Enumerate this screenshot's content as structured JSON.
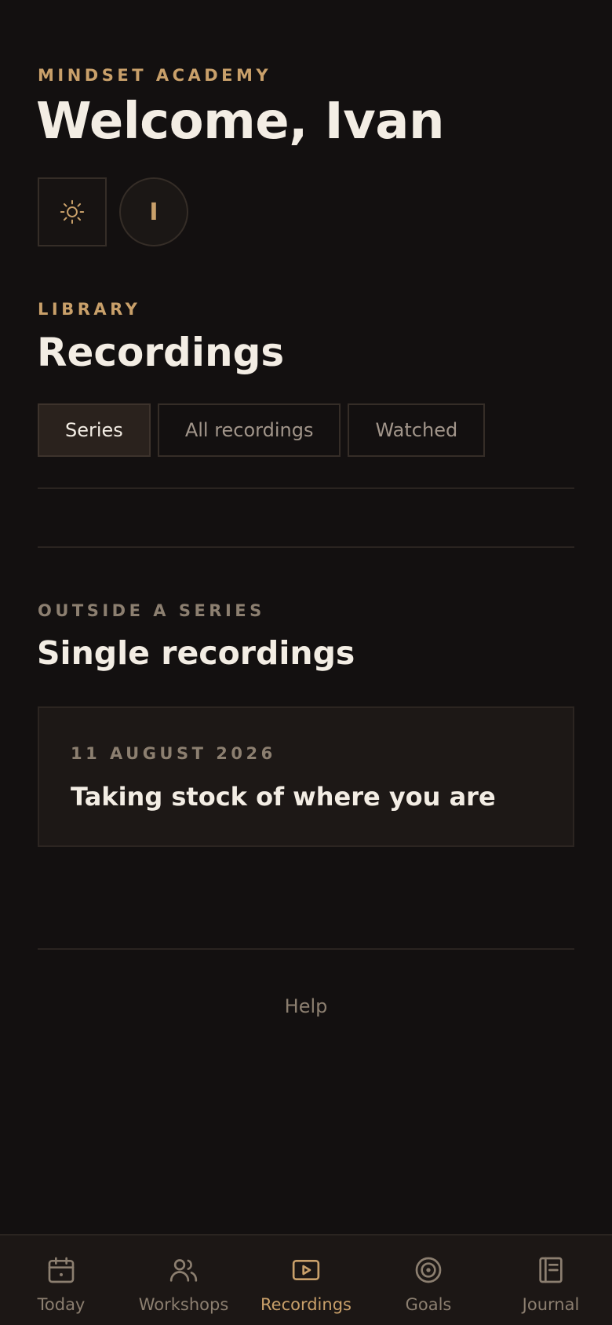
{
  "header": {
    "eyebrow": "MINDSET ACADEMY",
    "title": "Welcome, Ivan",
    "avatar_initial": "I"
  },
  "library": {
    "eyebrow": "LIBRARY",
    "title": "Recordings",
    "tabs": [
      {
        "label": "Series",
        "active": true
      },
      {
        "label": "All recordings",
        "active": false
      },
      {
        "label": "Watched",
        "active": false
      }
    ]
  },
  "singles": {
    "eyebrow": "OUTSIDE A SERIES",
    "title": "Single recordings",
    "items": [
      {
        "date": "11 AUGUST 2026",
        "title": "Taking stock of where you are"
      }
    ]
  },
  "footer": {
    "help_label": "Help"
  },
  "nav": {
    "items": [
      {
        "label": "Today",
        "icon": "calendar-icon"
      },
      {
        "label": "Workshops",
        "icon": "people-icon"
      },
      {
        "label": "Recordings",
        "icon": "play-icon",
        "active": true
      },
      {
        "label": "Goals",
        "icon": "target-icon"
      },
      {
        "label": "Journal",
        "icon": "journal-icon"
      }
    ]
  },
  "colors": {
    "background": "#131010",
    "accent": "#c9a06a",
    "muted": "#8c7f70",
    "text": "#f3ede4"
  }
}
